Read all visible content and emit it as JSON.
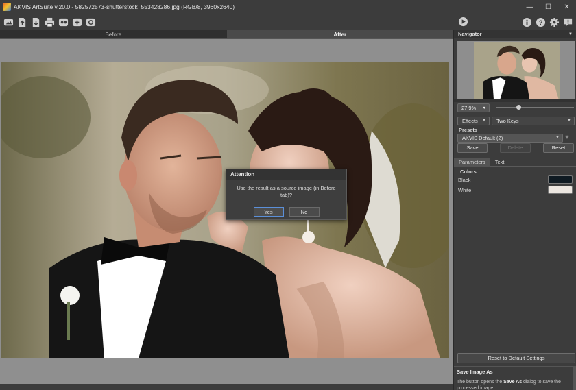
{
  "window": {
    "title": "AKVIS ArtSuite v.20.0 - 582572573-shutterstock_553428286.jpg (RGB/8, 3960x2640)",
    "controls": [
      "minimize-icon",
      "maximize-icon",
      "close-icon"
    ]
  },
  "toolbar": {
    "left_icons": [
      "home-icon",
      "open-file-icon",
      "save-file-icon",
      "print-icon",
      "share-icon",
      "batch-icon",
      "plugin-icon"
    ],
    "run_icon": "play-icon",
    "right_icons": [
      "info-icon",
      "help-icon",
      "settings-icon",
      "news-icon"
    ]
  },
  "view_tabs": {
    "before": "Before",
    "after": "After",
    "active": "After"
  },
  "dialog": {
    "title": "Attention",
    "message": "Use the result as a source image (in Before tab)?",
    "yes": "Yes",
    "no": "No"
  },
  "panel": {
    "navigator_title": "Navigator",
    "zoom": "27.9%",
    "effects_label": "Effects",
    "effect_value": "Two Keys",
    "presets_label": "Presets",
    "preset_value": "AKVIS Default (2)",
    "save": "Save",
    "delete": "Delete",
    "reset": "Reset",
    "tabs": [
      "Parameters",
      "Text"
    ],
    "active_tab": "Parameters",
    "colors_label": "Colors",
    "black_label": "Black",
    "white_label": "White",
    "black_color": "#0f1a22",
    "white_color": "#ece6e0",
    "reset_defaults": "Reset to Default Settings"
  },
  "help": {
    "title": "Save Image As",
    "text_prefix": "The button opens the ",
    "text_bold": "Save As",
    "text_suffix": " dialog to save the processed image."
  },
  "colors": {
    "accent": "#5b8fd8",
    "background": "#3c3c3c",
    "canvas": "#8f8f8f"
  }
}
